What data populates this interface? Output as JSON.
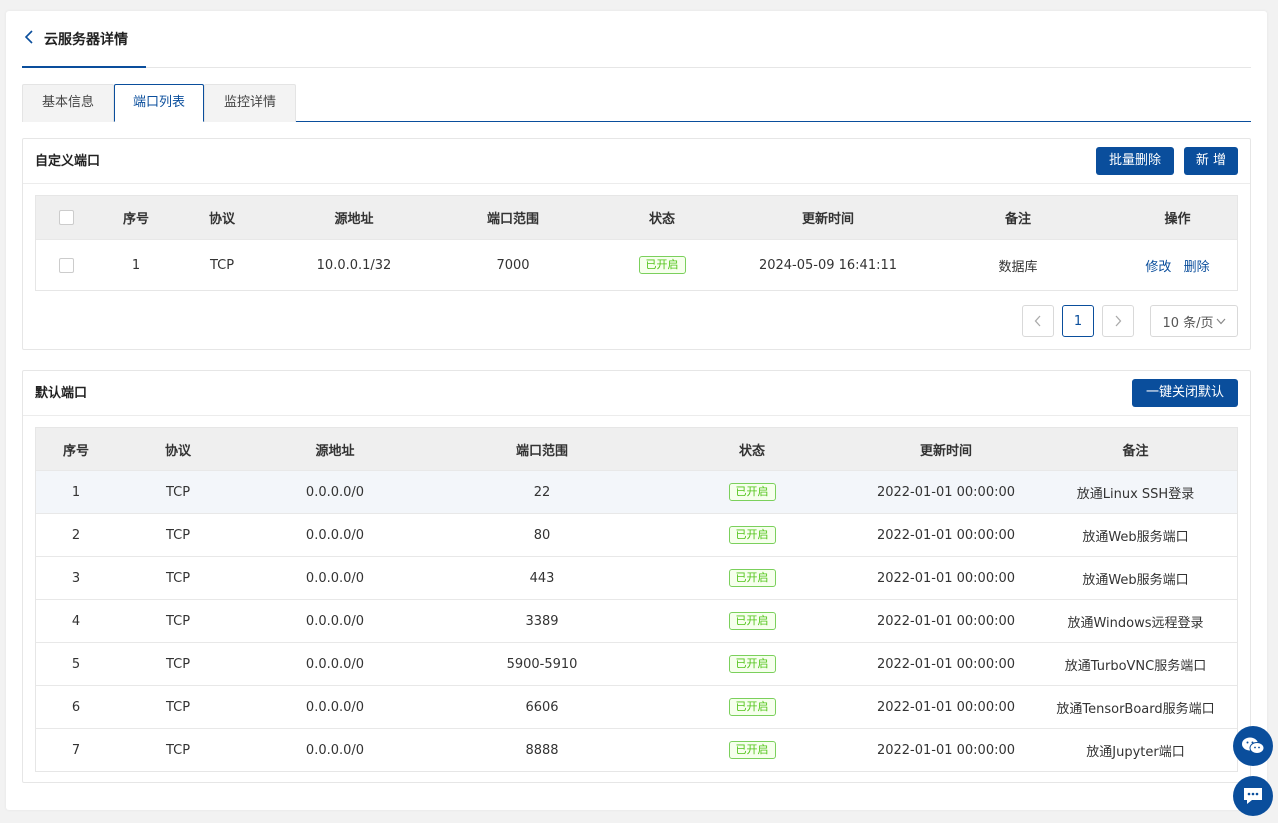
{
  "header": {
    "back_icon": "chevron-left-icon",
    "title": "云服务器详情"
  },
  "tabs": [
    {
      "label": "基本信息",
      "active": false
    },
    {
      "label": "端口列表",
      "active": true
    },
    {
      "label": "监控详情",
      "active": false
    }
  ],
  "custom_ports": {
    "title": "自定义端口",
    "batch_delete_label": "批量删除",
    "add_label": "新 增",
    "columns": [
      "序号",
      "协议",
      "源地址",
      "端口范围",
      "状态",
      "更新时间",
      "备注",
      "操作"
    ],
    "rows": [
      {
        "no": "1",
        "protocol": "TCP",
        "source": "10.0.0.1/32",
        "port": "7000",
        "status": "已开启",
        "updated": "2024-05-09 16:41:11",
        "remark": "数据库",
        "edit": "修改",
        "delete": "删除"
      }
    ],
    "pagination": {
      "current_page": "1",
      "page_size_label": "10 条/页"
    }
  },
  "default_ports": {
    "title": "默认端口",
    "close_all_label": "一键关闭默认",
    "columns": [
      "序号",
      "协议",
      "源地址",
      "端口范围",
      "状态",
      "更新时间",
      "备注"
    ],
    "rows": [
      {
        "no": "1",
        "protocol": "TCP",
        "source": "0.0.0.0/0",
        "port": "22",
        "status": "已开启",
        "updated": "2022-01-01 00:00:00",
        "remark": "放通Linux SSH登录"
      },
      {
        "no": "2",
        "protocol": "TCP",
        "source": "0.0.0.0/0",
        "port": "80",
        "status": "已开启",
        "updated": "2022-01-01 00:00:00",
        "remark": "放通Web服务端口"
      },
      {
        "no": "3",
        "protocol": "TCP",
        "source": "0.0.0.0/0",
        "port": "443",
        "status": "已开启",
        "updated": "2022-01-01 00:00:00",
        "remark": "放通Web服务端口"
      },
      {
        "no": "4",
        "protocol": "TCP",
        "source": "0.0.0.0/0",
        "port": "3389",
        "status": "已开启",
        "updated": "2022-01-01 00:00:00",
        "remark": "放通Windows远程登录"
      },
      {
        "no": "5",
        "protocol": "TCP",
        "source": "0.0.0.0/0",
        "port": "5900-5910",
        "status": "已开启",
        "updated": "2022-01-01 00:00:00",
        "remark": "放通TurboVNC服务端口"
      },
      {
        "no": "6",
        "protocol": "TCP",
        "source": "0.0.0.0/0",
        "port": "6606",
        "status": "已开启",
        "updated": "2022-01-01 00:00:00",
        "remark": "放通TensorBoard服务端口"
      },
      {
        "no": "7",
        "protocol": "TCP",
        "source": "0.0.0.0/0",
        "port": "8888",
        "status": "已开启",
        "updated": "2022-01-01 00:00:00",
        "remark": "放通Jupyter端口"
      }
    ]
  },
  "floating": {
    "wechat_icon": "wechat-icon",
    "chat_icon": "chat-icon"
  },
  "colors": {
    "primary": "#0a4e9c",
    "status_green": "#52c41a"
  }
}
